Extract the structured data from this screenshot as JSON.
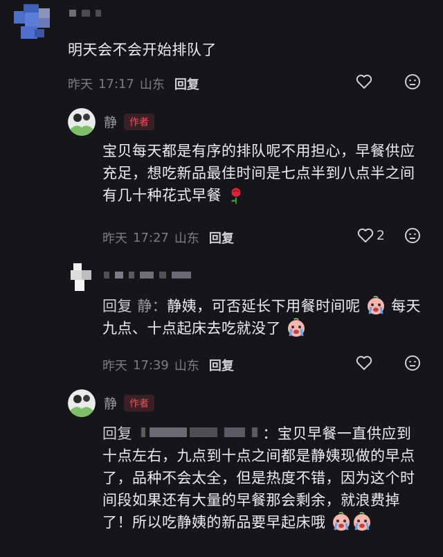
{
  "comments": [
    {
      "text": "明天会不会开始排队了",
      "meta": {
        "day": "昨天",
        "time": "17:17",
        "location": "山东",
        "reply": "回复"
      },
      "likes": ""
    },
    {
      "username": "静",
      "tag": "作者",
      "text_lines": [
        "宝贝每天都是有序的排队呢不用担心，早餐供应",
        "充足，想吃新品最佳时间是七点半到八点半之间",
        "有几十种花式早餐"
      ],
      "meta": {
        "day": "昨天",
        "time": "17:27",
        "location": "山东",
        "reply": "回复"
      },
      "likes": "2"
    },
    {
      "reply_prefix": "回复",
      "reply_target": "静：",
      "text_lines": [
        "静姨，可否延长下用餐时间呢",
        "每天",
        "九点、十点起床去吃就没了"
      ],
      "meta": {
        "day": "昨天",
        "time": "17:39",
        "location": "山东",
        "reply": "回复"
      },
      "likes": ""
    },
    {
      "username": "静",
      "tag": "作者",
      "reply_prefix": "回复",
      "text_lines": [
        "：宝贝早餐一直供应到",
        "十点左右，九点到十点之间都是静姨现做的早点",
        "了，品种不会太全，但是热度不错，因为这个时",
        "间段如果还有大量的早餐那会剩余，就浪费掉",
        "了！所以吃静姨的新品要早起床哦"
      ]
    }
  ],
  "icons": {
    "like": "heart-outline-icon",
    "dislike": "frown-face-icon",
    "flower": "rose-emoji",
    "cry": "crying-face-emoji"
  },
  "colors": {
    "background": "#16161a",
    "author_tag": "#fe4a5e",
    "meta": "#7c7c82"
  }
}
